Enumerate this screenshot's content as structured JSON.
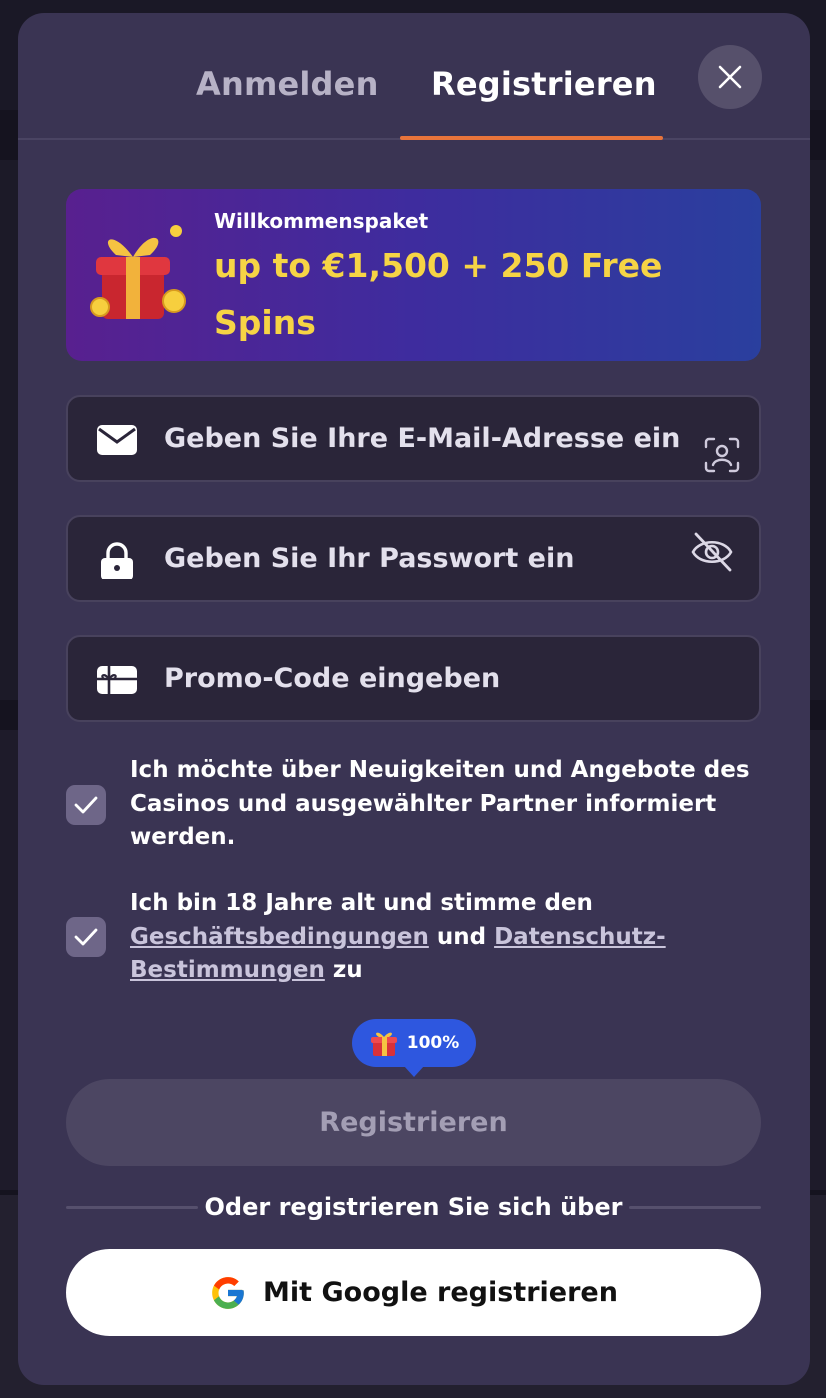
{
  "tabs": {
    "login": "Anmelden",
    "register": "Registrieren"
  },
  "promo": {
    "label": "Willkommenspaket",
    "headline": "up to €1,500 + 250 Free Spins"
  },
  "fields": {
    "email_placeholder": "Geben Sie Ihre E-Mail-Adresse ein",
    "password_placeholder": "Geben Sie Ihr Passwort ein",
    "promo_code_placeholder": "Promo-Code eingeben"
  },
  "consents": {
    "newsletter": {
      "checked": true,
      "text": "Ich möchte über Neuigkeiten und Angebote des Casinos und ausgewählter Partner informiert werden."
    },
    "terms": {
      "checked": true,
      "prefix": "Ich bin 18 Jahre alt und stimme den",
      "link1": "Geschäftsbedingungen",
      "middle": "und",
      "link2": "Datenschutz-Bestimmungen",
      "suffix": "zu"
    }
  },
  "bonus_badge": {
    "value": "100%",
    "icon": "gift-icon"
  },
  "submit": {
    "label": "Registrieren"
  },
  "social": {
    "divider_text": "Oder registrieren Sie sich über",
    "google_label": "Mit Google registrieren"
  },
  "colors": {
    "modal_bg": "#3a3453",
    "field_bg": "#2a2539",
    "accent_orange": "#e8743b",
    "promo_yellow": "#f6d445",
    "badge_blue": "#2e57df"
  }
}
